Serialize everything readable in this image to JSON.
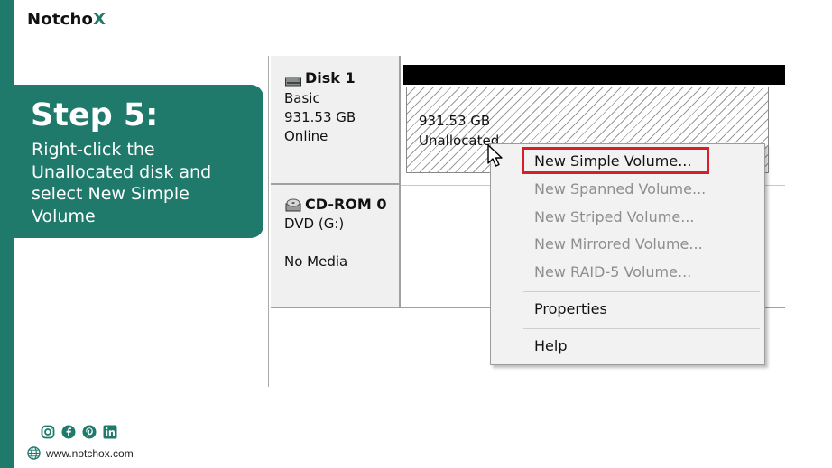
{
  "brand": {
    "name_prefix": "Notch",
    "name_o": "o",
    "name_x": "X",
    "accent": "#1f7a6c"
  },
  "step": {
    "title": "Step 5:",
    "description": "Right-click the Unallocated disk and select New Simple Volume"
  },
  "footer": {
    "social_icons": [
      "instagram-icon",
      "facebook-icon",
      "pinterest-icon",
      "linkedin-icon"
    ],
    "website": "www.notchox.com"
  },
  "disk_management": {
    "disk1": {
      "name": "Disk 1",
      "type": "Basic",
      "size": "931.53 GB",
      "status": "Online"
    },
    "volume": {
      "size": "931.53 GB",
      "state": "Unallocated"
    },
    "cdrom": {
      "name": "CD-ROM 0",
      "drive": "DVD (G:)",
      "media": "No Media"
    },
    "context_menu": {
      "items": [
        {
          "label": "New Simple Volume...",
          "enabled": true,
          "highlighted": true
        },
        {
          "label": "New Spanned Volume...",
          "enabled": false
        },
        {
          "label": "New Striped Volume...",
          "enabled": false
        },
        {
          "label": "New Mirrored Volume...",
          "enabled": false
        },
        {
          "label": "New RAID-5 Volume...",
          "enabled": false
        },
        {
          "label": "Properties",
          "enabled": true
        },
        {
          "label": "Help",
          "enabled": true
        }
      ],
      "highlight_color": "#d61f26"
    }
  }
}
